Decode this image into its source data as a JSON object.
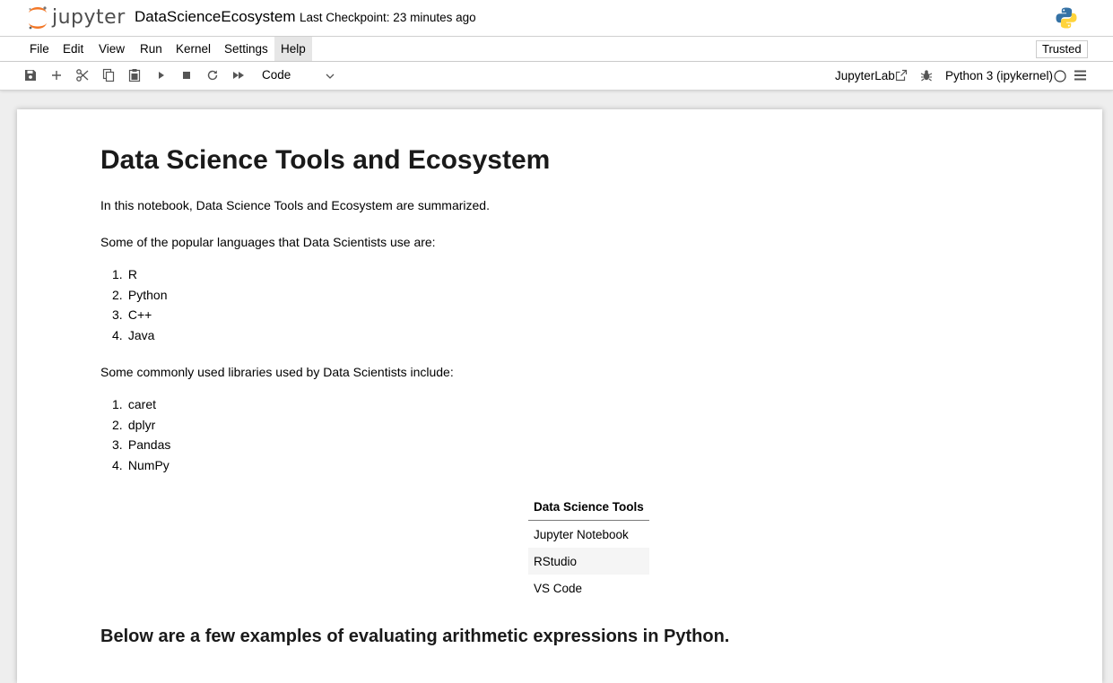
{
  "header": {
    "logo_text": "jupyter",
    "notebook_title": "DataScienceEcosystem",
    "checkpoint": "Last Checkpoint: 23 minutes ago"
  },
  "menu": {
    "items": [
      "File",
      "Edit",
      "View",
      "Run",
      "Kernel",
      "Settings",
      "Help"
    ],
    "active": "Help",
    "trusted": "Trusted"
  },
  "toolbar": {
    "cell_type": "Code",
    "jupyterlab_link": "JupyterLab",
    "kernel_name": "Python 3 (ipykernel)"
  },
  "notebook": {
    "title": "Data Science Tools and Ecosystem",
    "intro": "In this notebook, Data Science Tools and Ecosystem are summarized.",
    "languages_intro": "Some of the popular languages that Data Scientists use are:",
    "languages": [
      "R",
      "Python",
      "C++",
      "Java"
    ],
    "libraries_intro": "Some commonly used libraries used by Data Scientists include:",
    "libraries": [
      "caret",
      "dplyr",
      "Pandas",
      "NumPy"
    ],
    "tools_table": {
      "header": "Data Science Tools",
      "rows": [
        "Jupyter Notebook",
        "RStudio",
        "VS Code"
      ]
    },
    "arith_heading": "Below are a few examples of evaluating arithmetic expressions in Python."
  },
  "colors": {
    "jupyter_orange": "#F37726",
    "python_blue": "#3572A5",
    "python_yellow": "#FFD43B"
  }
}
